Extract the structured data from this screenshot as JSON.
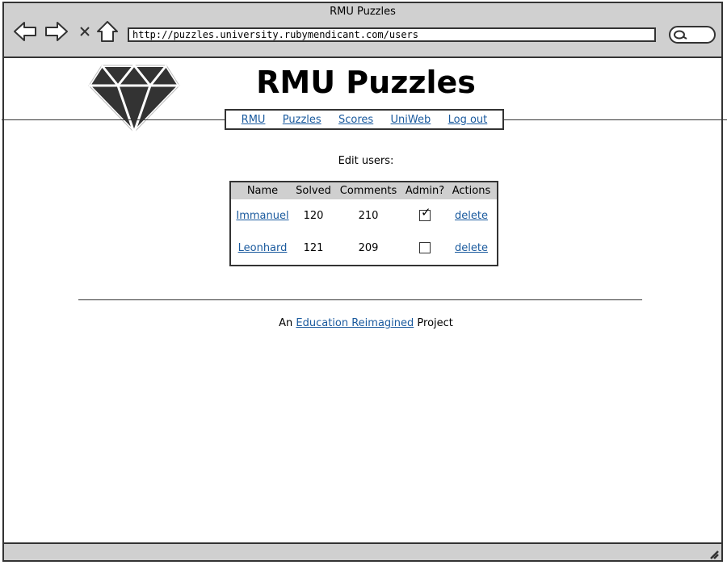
{
  "window": {
    "title": "RMU Puzzles"
  },
  "toolbar": {
    "url": "http://puzzles.university.rubymendicant.com/users",
    "back_icon": "back-arrow-icon",
    "forward_icon": "forward-arrow-icon",
    "stop_icon": "close-icon",
    "home_icon": "home-icon",
    "search_icon": "search-icon"
  },
  "site": {
    "title": "RMU Puzzles",
    "logo": "ruby-gem-logo"
  },
  "nav": {
    "items": [
      {
        "label": "RMU"
      },
      {
        "label": "Puzzles"
      },
      {
        "label": "Scores"
      },
      {
        "label": "UniWeb"
      },
      {
        "label": "Log out"
      }
    ]
  },
  "users": {
    "heading": "Edit users:",
    "columns": [
      "Name",
      "Solved",
      "Comments",
      "Admin?",
      "Actions"
    ],
    "rows": [
      {
        "name": "Immanuel",
        "solved": "120",
        "comments": "210",
        "admin": true,
        "action": "delete"
      },
      {
        "name": "Leonhard",
        "solved": "121",
        "comments": "209",
        "admin": false,
        "action": "delete"
      }
    ]
  },
  "footer": {
    "prefix": "An",
    "link": "Education Reimagined",
    "suffix": "Project"
  },
  "colors": {
    "chrome": "#d0d0d0",
    "link": "#1a5a9e",
    "table_header": "#cfcfcf"
  }
}
